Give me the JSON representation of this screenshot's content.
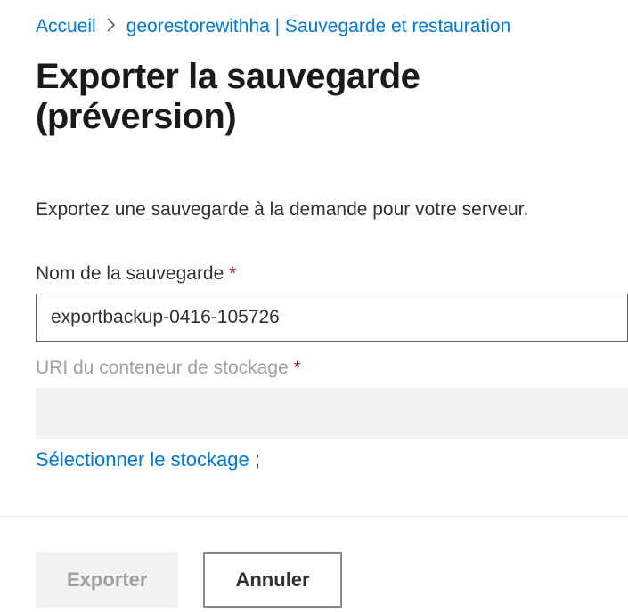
{
  "breadcrumb": {
    "home": "Accueil",
    "resource": "georestorewithha | Sauvegarde et restauration"
  },
  "page": {
    "title": "Exporter la sauvegarde (préversion)",
    "description": "Exportez une sauvegarde à la demande pour votre serveur."
  },
  "form": {
    "backup_name_label": "Nom de la sauvegarde",
    "backup_name_value": "exportbackup-0416-105726",
    "storage_uri_label": "URI du conteneur de stockage",
    "storage_uri_value": "",
    "select_storage_link": "Sélectionner le stockage",
    "semicolon": ";"
  },
  "footer": {
    "export_label": "Exporter",
    "cancel_label": "Annuler"
  }
}
